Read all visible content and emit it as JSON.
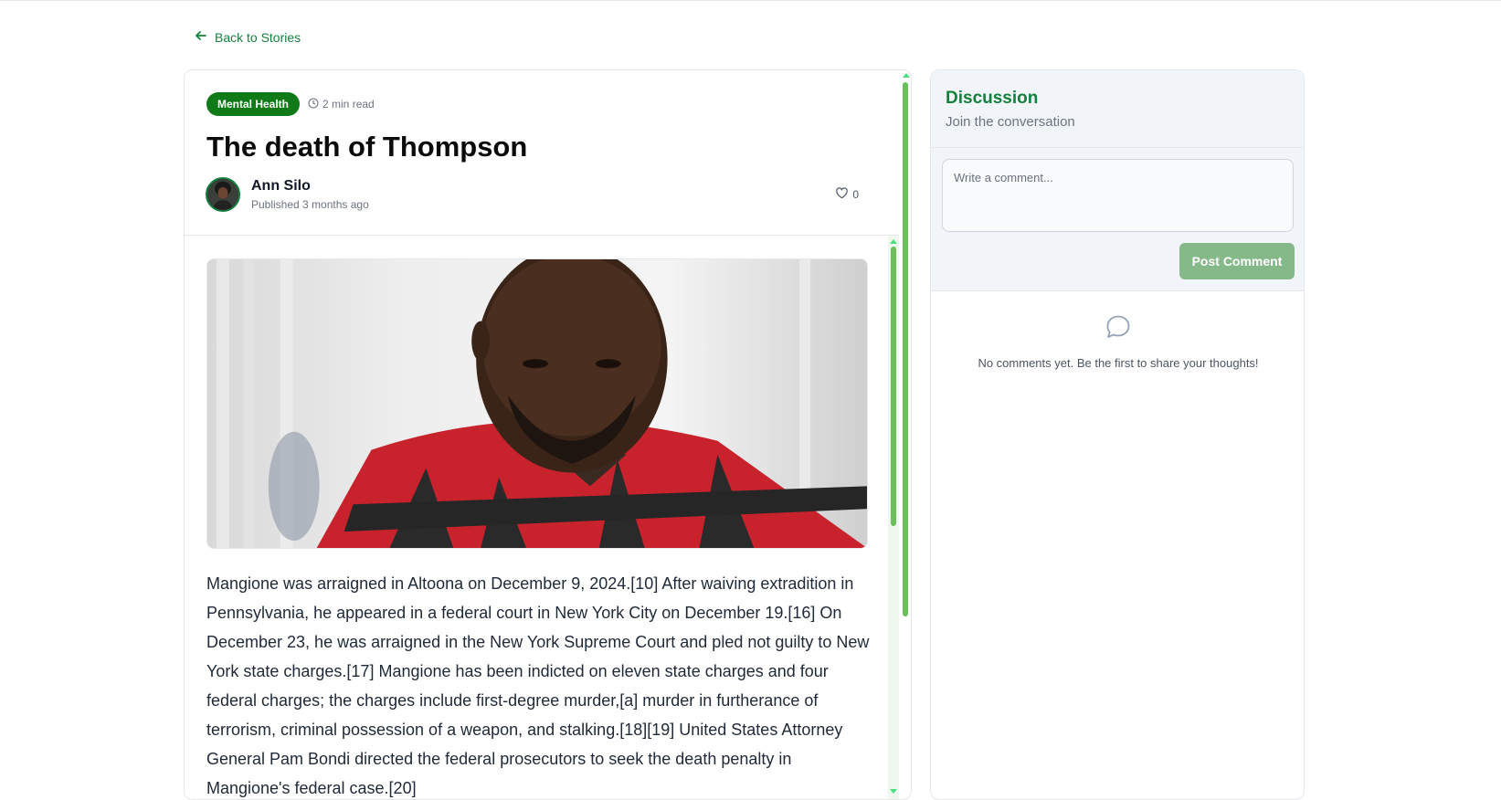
{
  "nav": {
    "back_label": "Back to Stories"
  },
  "story": {
    "category": "Mental Health",
    "read_time": "2 min read",
    "title": "The death of Thompson",
    "author": "Ann Silo",
    "published": "Published 3 months ago",
    "likes": "0",
    "body": "Mangione was arraigned in Altoona on December 9, 2024.[10] After waiving extradition in Pennsylvania, he appeared in a federal court in New York City on December 19.[16] On December 23, he was arraigned in the New York Supreme Court and pled not guilty to New York state charges.[17] Mangione has been indicted on eleven state charges and four federal charges; the charges include first-degree murder,[a] murder in furtherance of terrorism, criminal possession of a weapon, and stalking.[18][19] United States Attorney General Pam Bondi directed the federal prosecutors to seek the death penalty in Mangione's federal case.[20]"
  },
  "discussion": {
    "title": "Discussion",
    "subtitle": "Join the conversation",
    "comment_placeholder": "Write a comment...",
    "post_label": "Post Comment",
    "empty_text": "No comments yet. Be the first to share your thoughts!"
  },
  "icons": {
    "back": "arrow-left-icon",
    "clock": "clock-icon",
    "like": "heart-icon",
    "empty": "chat-bubble-icon"
  },
  "colors": {
    "accent": "#15803d",
    "tag_bg": "#0f7a17",
    "button_bg": "#86b98a",
    "panel_bg": "#f1f5f9",
    "scrollbar": "#6bbf5c"
  }
}
